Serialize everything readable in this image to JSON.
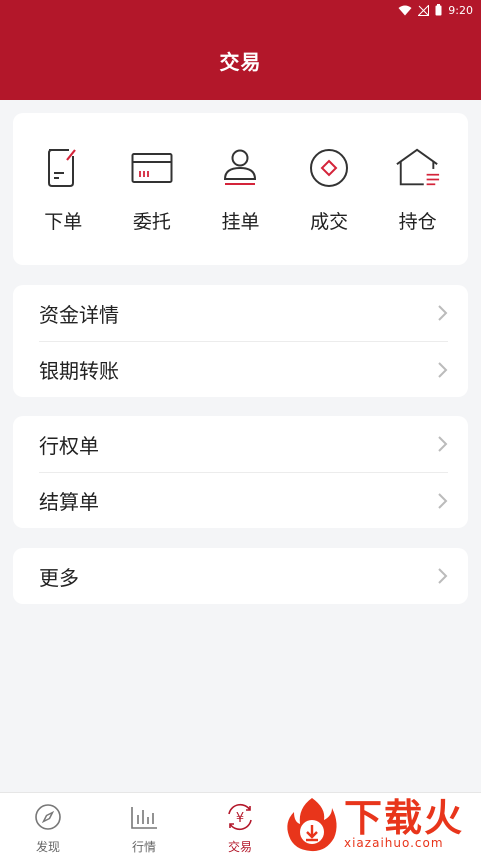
{
  "status": {
    "time": "9:20"
  },
  "header": {
    "title": "交易"
  },
  "quick": [
    {
      "label": "下单",
      "icon": "order-document-icon"
    },
    {
      "label": "委托",
      "icon": "card-icon"
    },
    {
      "label": "挂单",
      "icon": "user-icon"
    },
    {
      "label": "成交",
      "icon": "coin-icon"
    },
    {
      "label": "持仓",
      "icon": "house-icon"
    }
  ],
  "group1": [
    {
      "label": "资金详情"
    },
    {
      "label": "银期转账"
    }
  ],
  "group2": [
    {
      "label": "行权单"
    },
    {
      "label": "结算单"
    }
  ],
  "group3": [
    {
      "label": "更多"
    }
  ],
  "tabs": [
    {
      "label": "发现",
      "icon": "compass-icon"
    },
    {
      "label": "行情",
      "icon": "bar-chart-icon"
    },
    {
      "label": "交易",
      "icon": "yen-icon",
      "active": true
    }
  ],
  "watermark": {
    "title": "下载火",
    "url": "xiazaihuo.com"
  },
  "colors": {
    "brand": "#b3172a",
    "accent_line": "#d4243a",
    "icon_gray": "#333333"
  }
}
